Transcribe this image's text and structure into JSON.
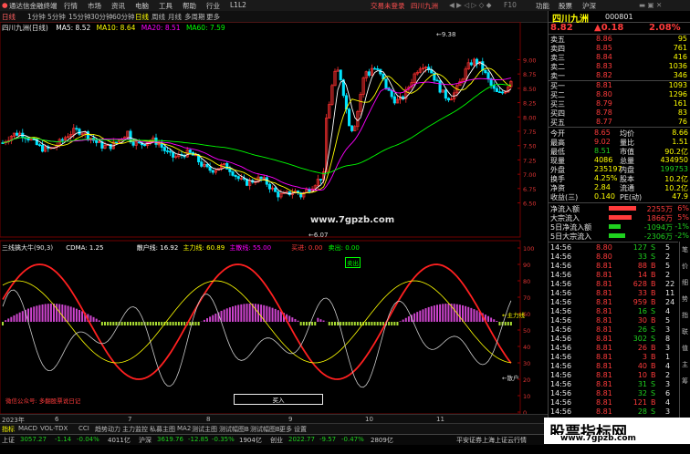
{
  "topbar": {
    "app": "通达信金融终端",
    "menus": [
      "行情",
      "市场",
      "资讯",
      "电脑",
      "工具",
      "帮助",
      "行业",
      "L1L2"
    ],
    "center": "交易未登录",
    "stock": "四川九洲",
    "right": [
      "功能",
      "股票",
      "沪深"
    ]
  },
  "toolbar": {
    "periods": [
      "日线",
      "1分钟",
      "5分钟",
      "15分钟",
      "30分钟",
      "60分钟",
      "日线",
      "周线",
      "月线",
      "多周期",
      "更多"
    ],
    "active_index": 6
  },
  "main_chart": {
    "title": "四川九洲(日线)",
    "ma_labels": [
      {
        "text": "MA5: 8.52",
        "color": "#ffffff"
      },
      {
        "text": "MA10: 8.64",
        "color": "#ffff00"
      },
      {
        "text": "MA20: 8.51",
        "color": "#ff00ff"
      },
      {
        "text": "MA60: 7.59",
        "color": "#00ff00"
      }
    ],
    "price_axis": [
      "9.00",
      "8.75",
      "8.50",
      "8.25",
      "8.00",
      "7.75",
      "7.50",
      "7.25",
      "7.00",
      "6.75",
      "6.50"
    ],
    "high_label": "9.38",
    "low_label": "6.07",
    "watermark": "www.7gpzb.com"
  },
  "indicator": {
    "name": "三线擒大牛(90,3)",
    "labels": [
      {
        "text": "CDMA: 1.25",
        "color": "#ffffff"
      },
      {
        "text": "散户线: 16.92",
        "color": "#ffffff"
      },
      {
        "text": "主力线: 60.89",
        "color": "#ffff00"
      },
      {
        "text": "主散线: 55.00",
        "color": "#ff00ff"
      },
      {
        "text": "买进: 0.00",
        "color": "#ff3b3b"
      },
      {
        "text": "卖出: 0.00",
        "color": "#00ff00"
      }
    ],
    "axis": [
      "100",
      "90",
      "80",
      "70",
      "60",
      "50",
      "40",
      "30",
      "20",
      "10",
      "0"
    ],
    "side_labels": [
      "主力线",
      "散户"
    ],
    "bottom_note": "微信公众号: 多翻股票说日记",
    "sell_badge": "卖出",
    "buy_badge": "买入"
  },
  "timeline": {
    "labels": [
      "2023年",
      "6",
      "7",
      "8",
      "9",
      "10",
      "11"
    ]
  },
  "bottom_tabs": {
    "row1": [
      "指标",
      "MACD",
      "VOL-TDX",
      "CCI",
      "趋势动力",
      "主力监控",
      "私募主图",
      "MA2",
      "测试主图",
      "测试幅图B",
      "测试幅图B",
      "更多",
      "设置"
    ],
    "row2": [
      "扩展A",
      "关联报价",
      "资金分布",
      "综合资讯",
      "行业资讯",
      "互动问答",
      "首页翻动说明"
    ]
  },
  "status": {
    "items": [
      {
        "label": "上证",
        "value": "3057.27",
        "chg": "-1.14",
        "pct": "-0.04%",
        "vol": "4011亿"
      },
      {
        "label": "沪深",
        "value": "3619.76",
        "chg": "-12.85",
        "pct": "-0.35%",
        "vol": "1904亿"
      },
      {
        "label": "创业",
        "value": "2022.77",
        "chg": "-9.57",
        "pct": "-0.47%",
        "vol": "2809亿"
      }
    ],
    "right": "平安证券上海上证云行情"
  },
  "quote": {
    "name": "四川九洲",
    "code": "000801",
    "price": "8.82",
    "change": "▲0.18",
    "pct": "2.08%",
    "asks": [
      {
        "label": "卖五",
        "price": "8.86",
        "vol": "95"
      },
      {
        "label": "卖四",
        "price": "8.85",
        "vol": "761"
      },
      {
        "label": "卖三",
        "price": "8.84",
        "vol": "416"
      },
      {
        "label": "卖二",
        "price": "8.83",
        "vol": "1036"
      },
      {
        "label": "卖一",
        "price": "8.82",
        "vol": "346"
      }
    ],
    "bids": [
      {
        "label": "买一",
        "price": "8.81",
        "vol": "1093"
      },
      {
        "label": "买二",
        "price": "8.80",
        "vol": "1296"
      },
      {
        "label": "买三",
        "price": "8.79",
        "vol": "161"
      },
      {
        "label": "买四",
        "price": "8.78",
        "vol": "83"
      },
      {
        "label": "买五",
        "price": "8.77",
        "vol": "76"
      }
    ],
    "stats": [
      {
        "l1": "今开",
        "v1": "8.65",
        "l2": "均价",
        "v2": "8.66"
      },
      {
        "l1": "最高",
        "v1": "9.02",
        "l2": "量比",
        "v2": "1.51"
      },
      {
        "l1": "最低",
        "v1": "8.51",
        "l2": "市值",
        "v2": "90.2亿"
      },
      {
        "l1": "现量",
        "v1": "4086",
        "l2": "总量",
        "v2": "434950"
      },
      {
        "l1": "外盘",
        "v1": "235197",
        "l2": "内盘",
        "v2": "199753"
      },
      {
        "l1": "换手",
        "v1": "4.25%",
        "l2": "股本",
        "v2": "10.2亿"
      },
      {
        "l1": "净资",
        "v1": "2.84",
        "l2": "流通",
        "v2": "10.2亿"
      },
      {
        "l1": "收益(三)",
        "v1": "0.140",
        "l2": "PE(动)",
        "v2": "47.9"
      }
    ],
    "flows": [
      {
        "label": "净流入额",
        "value": "2255万",
        "pct": "6%",
        "color": "#ff3b3b",
        "bar": 0.6
      },
      {
        "label": "大宗流入",
        "value": "1866万",
        "pct": "5%",
        "color": "#ff3b3b",
        "bar": 0.5
      },
      {
        "label": "5日净流入额",
        "value": "-1094万",
        "pct": "-1%",
        "color": "#1fd11f",
        "bar": 0.25
      },
      {
        "label": "5日大宗流入",
        "value": "-2306万",
        "pct": "-2%",
        "color": "#1fd11f",
        "bar": 0.35
      }
    ],
    "ticks": [
      {
        "time": "14:56",
        "price": "8.80",
        "vol": "127",
        "side": "S",
        "n": "5"
      },
      {
        "time": "14:56",
        "price": "8.80",
        "vol": "33",
        "side": "S",
        "n": "2"
      },
      {
        "time": "14:56",
        "price": "8.81",
        "vol": "88",
        "side": "B",
        "n": "5"
      },
      {
        "time": "14:56",
        "price": "8.81",
        "vol": "14",
        "side": "B",
        "n": "2"
      },
      {
        "time": "14:56",
        "price": "8.81",
        "vol": "628",
        "side": "B",
        "n": "22"
      },
      {
        "time": "14:56",
        "price": "8.81",
        "vol": "33",
        "side": "B",
        "n": "11"
      },
      {
        "time": "14:56",
        "price": "8.81",
        "vol": "959",
        "side": "B",
        "n": "24"
      },
      {
        "time": "14:56",
        "price": "8.81",
        "vol": "16",
        "side": "S",
        "n": "4"
      },
      {
        "time": "14:56",
        "price": "8.81",
        "vol": "30",
        "side": "B",
        "n": "5"
      },
      {
        "time": "14:56",
        "price": "8.81",
        "vol": "26",
        "side": "S",
        "n": "3"
      },
      {
        "time": "14:56",
        "price": "8.81",
        "vol": "302",
        "side": "S",
        "n": "8"
      },
      {
        "time": "14:56",
        "price": "8.81",
        "vol": "26",
        "side": "B",
        "n": "3"
      },
      {
        "time": "14:56",
        "price": "8.81",
        "vol": "3",
        "side": "B",
        "n": "1"
      },
      {
        "time": "14:56",
        "price": "8.81",
        "vol": "40",
        "side": "B",
        "n": "4"
      },
      {
        "time": "14:56",
        "price": "8.81",
        "vol": "10",
        "side": "B",
        "n": "2"
      },
      {
        "time": "14:56",
        "price": "8.81",
        "vol": "31",
        "side": "S",
        "n": "3"
      },
      {
        "time": "14:56",
        "price": "8.81",
        "vol": "32",
        "side": "S",
        "n": "6"
      },
      {
        "time": "14:56",
        "price": "8.81",
        "vol": "121",
        "side": "B",
        "n": "4"
      },
      {
        "time": "14:56",
        "price": "8.81",
        "vol": "28",
        "side": "S",
        "n": "3"
      }
    ],
    "tabs": [
      "笔",
      "价",
      "细",
      "势",
      "指",
      "联",
      "值",
      "主",
      "筹"
    ]
  },
  "site_watermark": {
    "title": "股票指标网",
    "url": "www.7gpzb.com"
  }
}
